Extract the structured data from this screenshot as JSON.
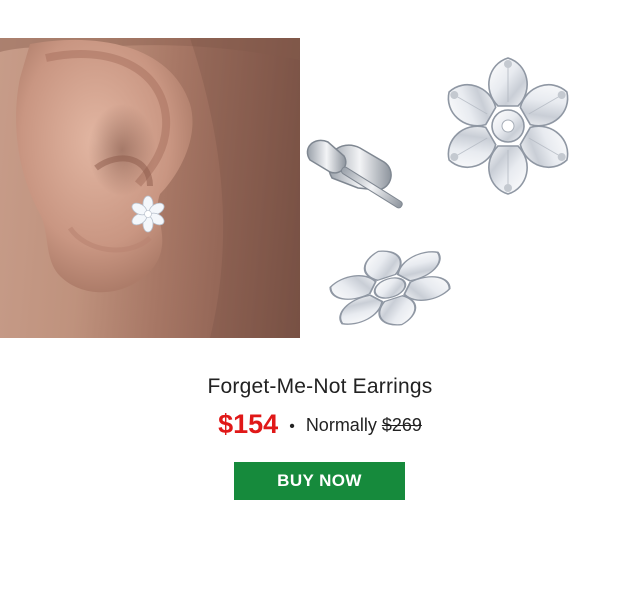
{
  "product": {
    "name": "Forget-Me-Not Earrings",
    "sale_price": "$154",
    "separator": "•",
    "normally_label": "Normally",
    "original_price": "$269",
    "buy_label": "BUY NOW"
  },
  "colors": {
    "sale_price": "#e01818",
    "button": "#168a3c"
  }
}
